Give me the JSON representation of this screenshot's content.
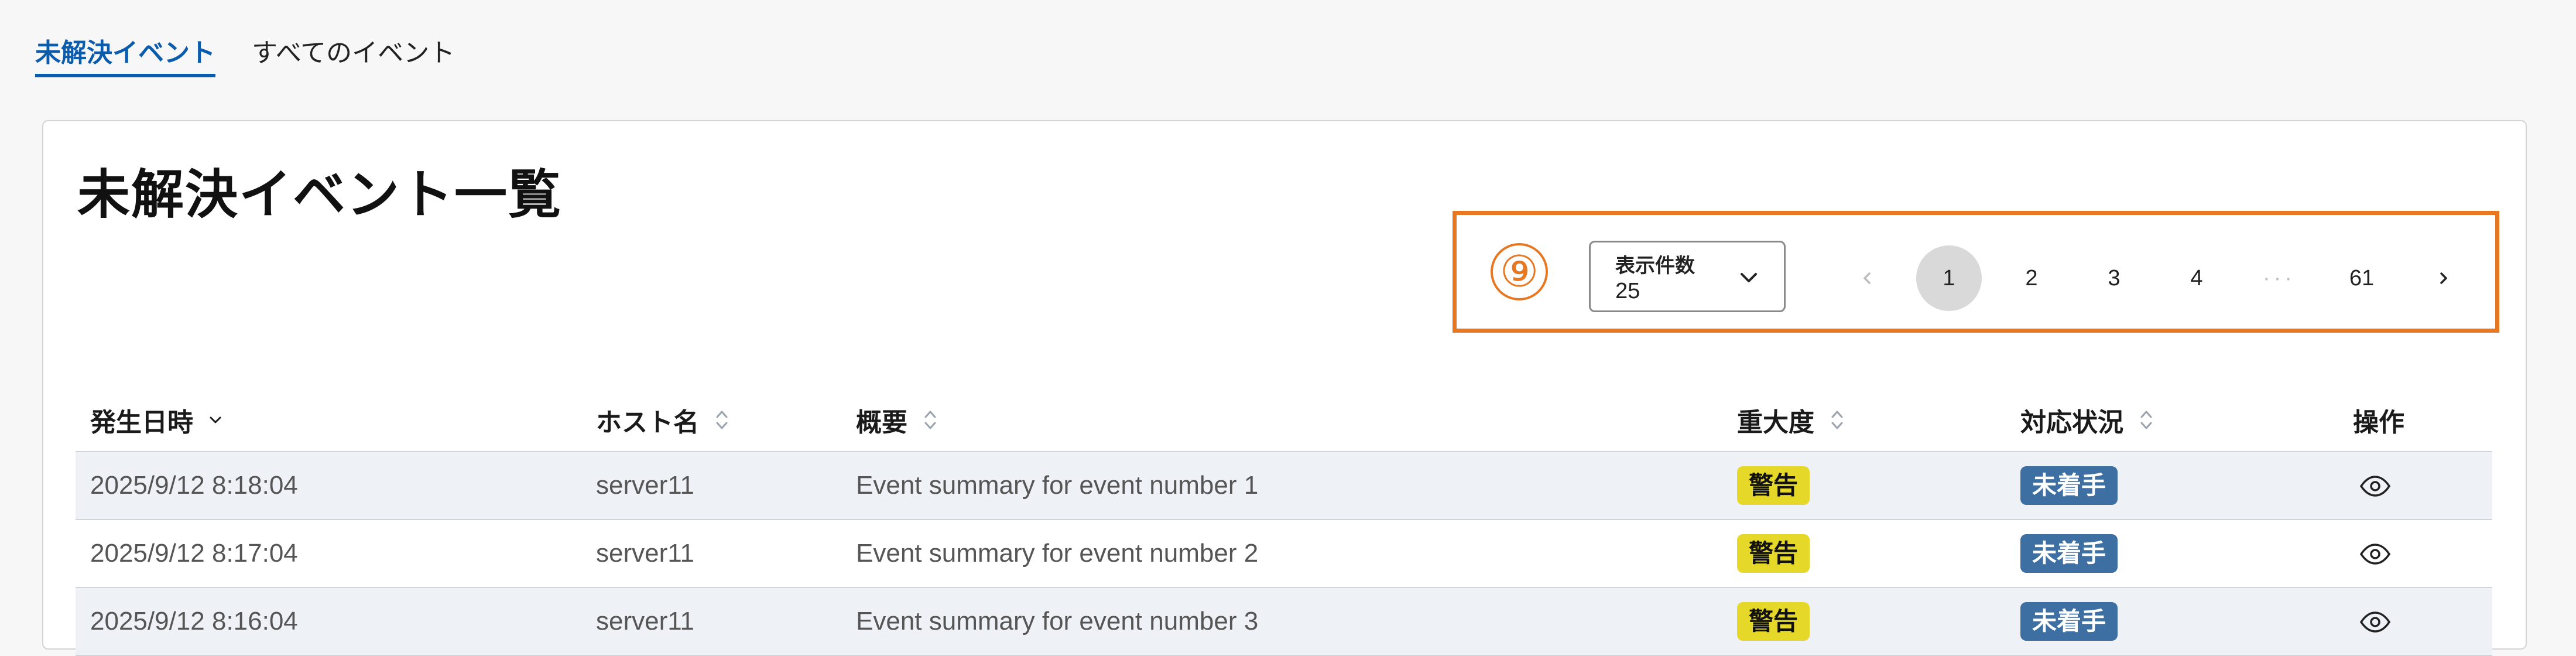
{
  "tabs": [
    {
      "label": "未解決イベント",
      "active": true
    },
    {
      "label": "すべてのイベント",
      "active": false
    }
  ],
  "page_title": "未解決イベント一覧",
  "annotation_marker": "⑨",
  "page_size": {
    "label": "表示件数",
    "value": "25"
  },
  "pagination": {
    "prev_icon": "chevron-left-icon",
    "next_icon": "chevron-right-icon",
    "pages": [
      "1",
      "2",
      "3",
      "4"
    ],
    "ellipsis": "···",
    "last_page": "61",
    "current": "1"
  },
  "table": {
    "headers": {
      "date": "発生日時",
      "host": "ホスト名",
      "summary": "概要",
      "severity": "重大度",
      "status": "対応状況",
      "action": "操作"
    },
    "rows": [
      {
        "date": "2025/9/12 8:18:04",
        "host": "server11",
        "summary": "Event summary for event number 1",
        "severity": "警告",
        "status": "未着手"
      },
      {
        "date": "2025/9/12 8:17:04",
        "host": "server11",
        "summary": "Event summary for event number 2",
        "severity": "警告",
        "status": "未着手"
      },
      {
        "date": "2025/9/12 8:16:04",
        "host": "server11",
        "summary": "Event summary for event number 3",
        "severity": "警告",
        "status": "未着手"
      }
    ]
  },
  "colors": {
    "accent": "#0b5cad",
    "highlight": "#e87722",
    "warning_badge": "#e5d829",
    "status_badge": "#3d6fa3",
    "row_stripe": "#eef1f5"
  }
}
